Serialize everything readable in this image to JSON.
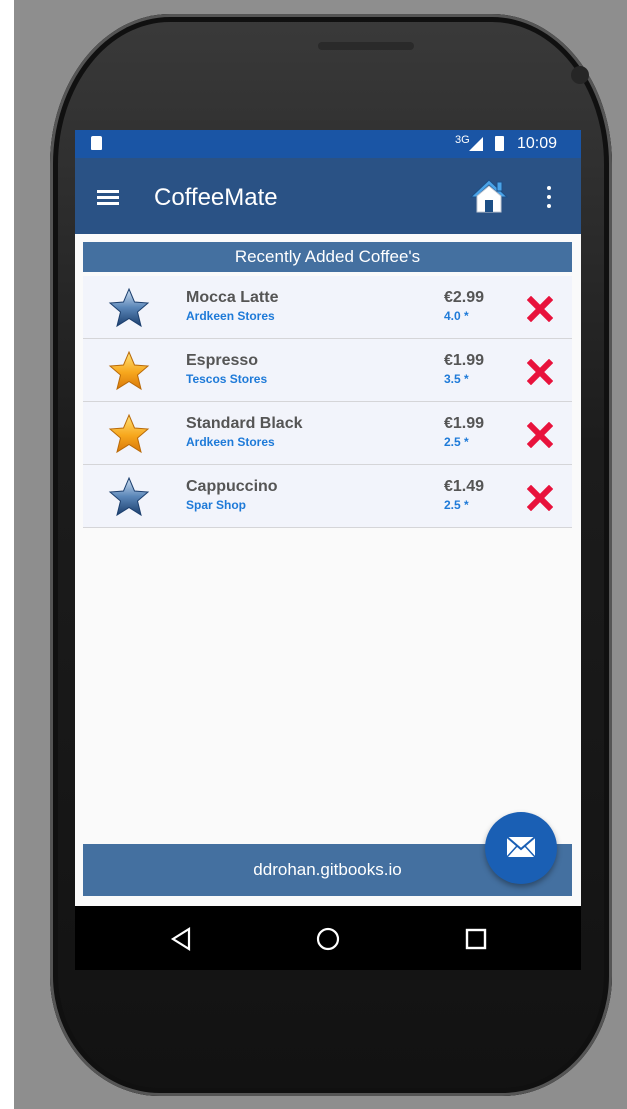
{
  "status_bar": {
    "network": "3G",
    "time": "10:09"
  },
  "app_bar": {
    "title": "CoffeeMate",
    "menu_icon": "hamburger-menu-icon",
    "home_icon": "home-icon",
    "overflow_icon": "more-vert-icon"
  },
  "section_header": "Recently Added Coffee's",
  "coffees": [
    {
      "name": "Mocca Latte",
      "shop": "Ardkeen Stores",
      "price": "€2.99",
      "rating": "4.0 *",
      "favourite": false
    },
    {
      "name": "Espresso",
      "shop": "Tescos Stores",
      "price": "€1.99",
      "rating": "3.5 *",
      "favourite": true
    },
    {
      "name": "Standard Black",
      "shop": "Ardkeen Stores",
      "price": "€1.99",
      "rating": "2.5 *",
      "favourite": true
    },
    {
      "name": "Cappuccino",
      "shop": "Spar Shop",
      "price": "€1.49",
      "rating": "2.5 *",
      "favourite": false
    }
  ],
  "footer": "ddrohan.gitbooks.io",
  "fab_icon": "email-icon",
  "nav_bar": {
    "back_icon": "back-triangle-icon",
    "home_icon": "home-circle-icon",
    "recents_icon": "recents-square-icon"
  },
  "colors": {
    "status_bar": "#1a55a5",
    "app_bar": "#2a5285",
    "header_band": "#4470a0",
    "accent_blue": "#1e7ad8",
    "delete_red": "#e8123c",
    "fab": "#1a5fb4"
  }
}
